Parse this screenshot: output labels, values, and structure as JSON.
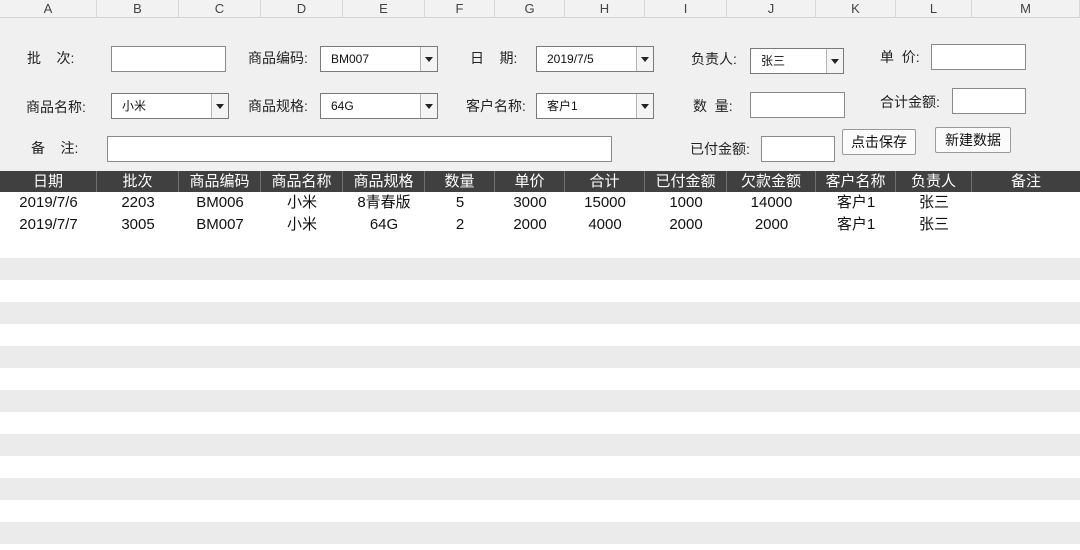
{
  "column_letters": [
    "A",
    "B",
    "C",
    "D",
    "E",
    "F",
    "G",
    "H",
    "I",
    "J",
    "K",
    "L",
    "M"
  ],
  "form": {
    "batch_label": "批    次:",
    "product_code_label": "商品编码:",
    "product_code_value": "BM007",
    "date_label": "日    期:",
    "date_value": "2019/7/5",
    "owner_label": "负责人:",
    "owner_value": "张三",
    "unit_price_label": "单  价:",
    "product_name_label": "商品名称:",
    "product_name_value": "小米",
    "product_spec_label": "商品规格:",
    "product_spec_value": "64G",
    "customer_label": "客户名称:",
    "customer_value": "客户1",
    "quantity_label": "数  量:",
    "total_label": "合计金额:",
    "note_label": "备    注:",
    "paid_label": "已付金额:",
    "save_button": "点击保存",
    "new_button": "新建数据"
  },
  "table": {
    "headers": [
      "日期",
      "批次",
      "商品编码",
      "商品名称",
      "商品规格",
      "数量",
      "单价",
      "合计",
      "已付金额",
      "欠款金额",
      "客户名称",
      "负责人",
      "备注"
    ],
    "rows": [
      [
        "2019/7/6",
        "2203",
        "BM006",
        "小米",
        "8青春版",
        "5",
        "3000",
        "15000",
        "1000",
        "14000",
        "客户1",
        "张三",
        ""
      ],
      [
        "2019/7/7",
        "3005",
        "BM007",
        "小米",
        "64G",
        "2",
        "2000",
        "4000",
        "2000",
        "2000",
        "客户1",
        "张三",
        ""
      ]
    ]
  }
}
